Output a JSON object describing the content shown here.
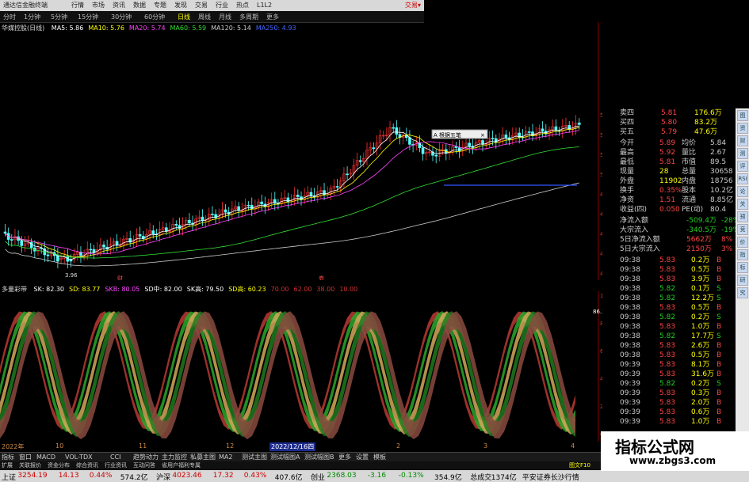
{
  "app": {
    "title": "通达信金融终端",
    "top_right": "交易▾",
    "menu": [
      "行情",
      "市场",
      "资讯",
      "数据",
      "专题",
      "发现",
      "交易",
      "行业",
      "热点",
      "L1L2"
    ]
  },
  "toolbar": {
    "items": [
      "分时",
      "1分钟",
      "5分钟",
      "15分钟",
      "30分钟",
      "60分钟",
      "日线",
      "周线",
      "月线",
      "多周期",
      "更多"
    ]
  },
  "stock": {
    "name": "华媒控股(日线)",
    "mas": [
      {
        "label": "MA5: 5.86",
        "color": "#ffffff"
      },
      {
        "label": "MA10: 5.76",
        "color": "#ffff00"
      },
      {
        "label": "MA20: 5.74",
        "color": "#ff44ff"
      },
      {
        "label": "MA60: 5.59",
        "color": "#33dd33"
      },
      {
        "label": "MA120: 5.14",
        "color": "#cccccc"
      },
      {
        "label": "MA250: 4.93",
        "color": "#4466ff"
      }
    ]
  },
  "chart": {
    "low_label": "3.96",
    "popup_text": "A 根据五笔",
    "popup_btn": "×"
  },
  "indicator": {
    "name": "多量彩带",
    "fields": [
      {
        "label": "SK: 82.30",
        "color": "#ffffff"
      },
      {
        "label": "SD: 83.77",
        "color": "#ffff00"
      },
      {
        "label": "SKB: 80.05",
        "color": "#ff44ff"
      },
      {
        "label": "SD中: 82.00",
        "color": "#ffffff"
      },
      {
        "label": "SK高: 79.50",
        "color": "#ffffff"
      },
      {
        "label": "SD高: 60.23",
        "color": "#ffff00"
      },
      {
        "label": "70.00",
        "color": "#cc3333"
      },
      {
        "label": "62.00",
        "color": "#cc3333"
      },
      {
        "label": "38.00",
        "color": "#cc3333"
      },
      {
        "label": "10.00",
        "color": "#cc3333"
      }
    ],
    "value_tag": "86.35"
  },
  "price_axis": [
    "5.60",
    "5.40",
    "5.20",
    "5.00",
    "4.80",
    "4.60",
    "4.40",
    "4.20",
    "4.00"
  ],
  "ind_axis": [
    "100.00",
    "80.00",
    "60.00",
    "40.00",
    "20.00",
    "0.00"
  ],
  "date_axis": {
    "d1": "2022年",
    "d2": "10",
    "d3": "11",
    "d4": "12",
    "d5": "2022/12/16四",
    "d6": "2",
    "d7": "3",
    "d8": "4"
  },
  "marker_left": "财",
  "marker_mid": "券",
  "quote": {
    "asks": [
      {
        "label": "卖四",
        "price": "5.81",
        "vol": "176.6万"
      },
      {
        "label": "买四",
        "price": "5.80",
        "vol": "83.2万"
      },
      {
        "label": "买五",
        "price": "5.79",
        "vol": "47.6万"
      }
    ],
    "stats": [
      {
        "l1": "今开",
        "v1": "5.89",
        "l2": "均价",
        "v2": "5.84"
      },
      {
        "l1": "最高",
        "v1": "5.92",
        "l2": "量比",
        "v2": "2.67"
      },
      {
        "l1": "最低",
        "v1": "5.81",
        "l2": "市值",
        "v2": "89.5"
      },
      {
        "l1": "现量",
        "v1": "28",
        "l2": "总量",
        "v2": "30658"
      },
      {
        "l1": "外盘",
        "v1": "11902",
        "l2": "内盘",
        "v2": "18756"
      },
      {
        "l1": "换手",
        "v1": "0.35%",
        "l2": "股本",
        "v2": "10.2亿"
      },
      {
        "l1": "净资",
        "v1": "1.51",
        "l2": "流通",
        "v2": "8.85亿"
      },
      {
        "l1": "收益(四)",
        "v1": "0.050",
        "l2": "PE(动)",
        "v2": "80.4"
      }
    ],
    "flows": [
      {
        "label": "净流入额",
        "val": "-509.4万",
        "pct": "-28%"
      },
      {
        "label": "大宗流入",
        "val": "-340.5万",
        "pct": "-19%"
      },
      {
        "label": "5日净流入额",
        "val": "5662万",
        "pct": "8%"
      },
      {
        "label": "5日大宗流入",
        "val": "2150万",
        "pct": "3%"
      }
    ],
    "ticks": [
      {
        "t": "09:38",
        "p": "5.83",
        "v": "0.2万",
        "d": "B"
      },
      {
        "t": "09:38",
        "p": "5.83",
        "v": "0.5万",
        "d": "B"
      },
      {
        "t": "09:38",
        "p": "5.83",
        "v": "3.9万",
        "d": "B"
      },
      {
        "t": "09:38",
        "p": "5.82",
        "v": "0.1万",
        "d": "S"
      },
      {
        "t": "09:38",
        "p": "5.82",
        "v": "12.2万",
        "d": "S"
      },
      {
        "t": "09:38",
        "p": "5.83",
        "v": "0.5万",
        "d": "B"
      },
      {
        "t": "09:38",
        "p": "5.82",
        "v": "0.2万",
        "d": "S"
      },
      {
        "t": "09:38",
        "p": "5.83",
        "v": "1.0万",
        "d": "B"
      },
      {
        "t": "09:38",
        "p": "5.82",
        "v": "17.7万",
        "d": "S"
      },
      {
        "t": "09:38",
        "p": "5.83",
        "v": "2.6万",
        "d": "B"
      },
      {
        "t": "09:38",
        "p": "5.83",
        "v": "0.5万",
        "d": "B"
      },
      {
        "t": "09:39",
        "p": "5.83",
        "v": "8.1万",
        "d": "B"
      },
      {
        "t": "09:39",
        "p": "5.83",
        "v": "31.6万",
        "d": "B"
      },
      {
        "t": "09:39",
        "p": "5.82",
        "v": "0.2万",
        "d": "S"
      },
      {
        "t": "09:39",
        "p": "5.83",
        "v": "0.3万",
        "d": "B"
      },
      {
        "t": "09:39",
        "p": "5.83",
        "v": "2.0万",
        "d": "B"
      },
      {
        "t": "09:39",
        "p": "5.83",
        "v": "0.6万",
        "d": "B"
      },
      {
        "t": "09:39",
        "p": "5.83",
        "v": "1.0万",
        "d": "B"
      }
    ]
  },
  "side_buttons": [
    "图",
    "资",
    "财",
    "测",
    "评",
    "RSI",
    "论",
    "关",
    "预",
    "竞",
    "价",
    "指",
    "标",
    "研",
    "究"
  ],
  "tabs": [
    "指标",
    "窗口",
    "MACD",
    "VOL-TDX",
    "CCI",
    "趋势动力",
    "主力监控",
    "私募主图",
    "MA2",
    "测试主图",
    "测试幅图A",
    "测试幅图B",
    "更多",
    "设置",
    "模板"
  ],
  "tabs2": [
    "扩展",
    "关联报价",
    "资金分布",
    "综合资讯",
    "行业资讯",
    "互动问答",
    "省用户福利专属"
  ],
  "tab_right": "图文F10",
  "status": [
    {
      "label": "上证",
      "color": "#000"
    },
    {
      "label": "3254.19",
      "color": "#c00"
    },
    {
      "label": "14.13",
      "color": "#c00"
    },
    {
      "label": "0.44%",
      "color": "#c00"
    },
    {
      "label": "574.2亿",
      "color": "#000"
    },
    {
      "label": "沪深",
      "color": "#000"
    },
    {
      "label": "4023.46",
      "color": "#c00"
    },
    {
      "label": "17.32",
      "color": "#c00"
    },
    {
      "label": "0.43%",
      "color": "#c00"
    },
    {
      "label": "407.6亿",
      "color": "#000"
    },
    {
      "label": "创业",
      "color": "#000"
    },
    {
      "label": "2368.03",
      "color": "#080"
    },
    {
      "label": "-3.16",
      "color": "#080"
    },
    {
      "label": "-0.13%",
      "color": "#080"
    },
    {
      "label": "354.9亿",
      "color": "#000"
    },
    {
      "label": "总成交",
      "color": "#000"
    },
    {
      "label": "1374亿",
      "color": "#000"
    },
    {
      "label": "平安证券长沙行情",
      "color": "#000"
    }
  ],
  "watermark": {
    "l1": "指标公式网",
    "l2": "www.zbgs3.com"
  }
}
